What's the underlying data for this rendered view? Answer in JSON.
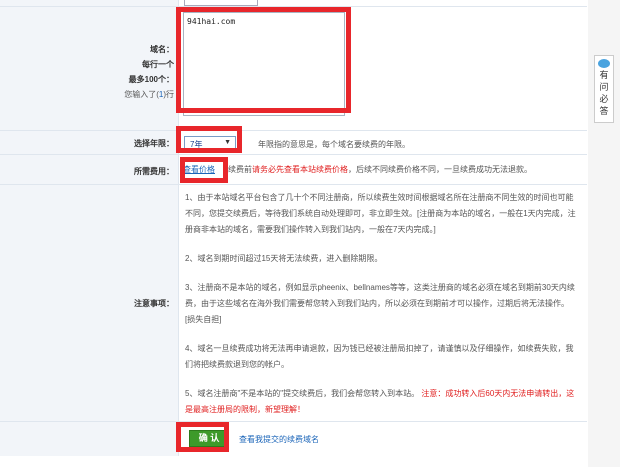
{
  "domain_form": {
    "label_lines": [
      "域名：",
      "每行一个",
      "最多100个："
    ],
    "count_prefix": "您输入了(",
    "count_value": "1",
    "count_suffix": ")行",
    "textarea_value": "941hai.com"
  },
  "year": {
    "label": "选择年限：",
    "selected": "7年",
    "hint": "年限指的意思是，每个域名要续费的年限。"
  },
  "fee": {
    "label": "所需费用：",
    "link": "查看价格",
    "text_pre": "续费前",
    "text_red": "请务必先查看本站续费价格",
    "text_post": "，后续不同续费价格不同，一旦续费成功无法退款。"
  },
  "notes": {
    "label": "注意事项：",
    "p1": "1、由于本站域名平台包含了几十个不同注册商，所以续费生效时间根据域名所在注册商不同生效的时间也可能不同，您提交续费后，等待我们系统自动处理即可，非立即生效。[注册商为本站的域名，一般在1天内完成，注册商非本站的域名，需要我们操作转入到我们站内，一般在7天内完成。]",
    "p2": "2、域名到期时间超过15天将无法续费，进入删除期限。",
    "p3": "3、注册商不是本站的域名，例如显示pheenix、bellnames等等，这类注册商的域名必须在域名到期前30天内续费，由于这些域名在海外我们需要帮您转入到我们站内，所以必须在到期前才可以操作，过期后将无法操作。[损失自担]",
    "p4": "4、域名一旦续费成功将无法再申请退款，因为钱已经被注册局扣掉了，请谨慎以及仔细操作，如续费失败，我们将把续费款退到您的帐户。",
    "p5_pre": "5、域名注册商\"不是本站的\"提交续费后，我们会帮您转入到本站。",
    "p5_red": "注意：成功转入后60天内无法申请转出，这是最高注册局的限制，新望理解！"
  },
  "submit": {
    "button": "确 认",
    "link": "查看我提交的续费域名"
  },
  "help": {
    "label": "有问必答"
  }
}
